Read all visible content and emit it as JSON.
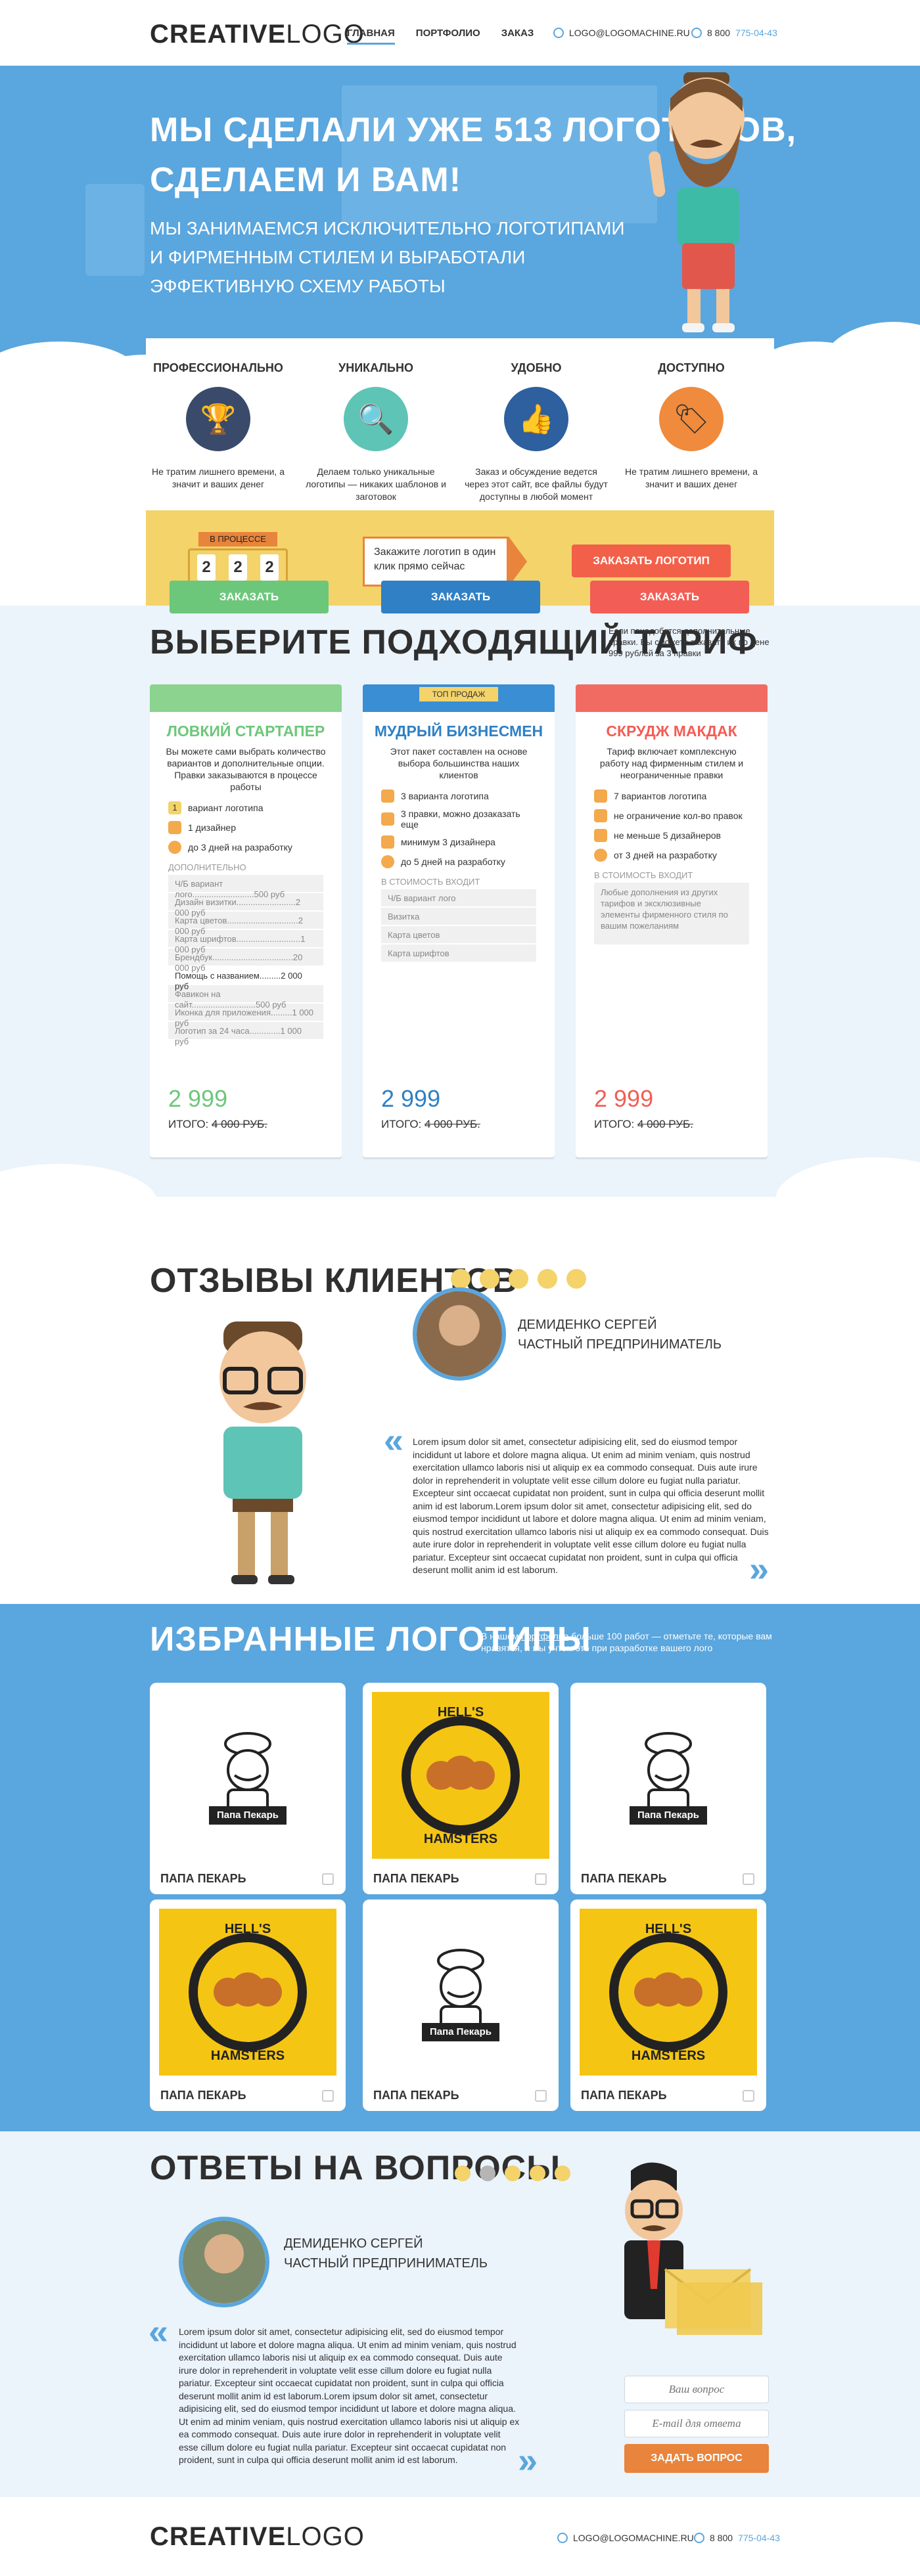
{
  "header": {
    "logo_bold": "CREATIVE",
    "logo_light": "LOGO",
    "nav": [
      "ГЛАВНАЯ",
      "ПОРТФОЛИО",
      "ЗАКАЗ"
    ],
    "email": "LOGO@LOGOMACHINE.RU",
    "phone_prefix": "8 800",
    "phone_rest": "775-04-43"
  },
  "hero": {
    "title_line1": "МЫ СДЕЛАЛИ УЖЕ 513 ЛОГОТИПОВ,",
    "title_line2": "СДЕЛАЕМ И ВАМ!",
    "subtitle": "МЫ ЗАНИМАЕМСЯ ИСКЛЮЧИТЕЛЬНО ЛОГОТИПАМИ И ФИРМЕННЫМ СТИЛЕМ И ВЫРАБОТАЛИ ЭФФЕКТИВНУЮ СХЕМУ РАБОТЫ"
  },
  "features": [
    {
      "title": "ПРОФЕССИОНАЛЬНО",
      "text": "Не тратим лишнего времени, а значит и ваших денег",
      "icon": "trophy-icon",
      "color": "#3a4a6b",
      "glyph": "🏆"
    },
    {
      "title": "УНИКАЛЬНО",
      "text": "Делаем только уникальные логотипы — никаких шаблонов и заготовок",
      "icon": "magnifier-icon",
      "color": "#5ec4b6",
      "glyph": "🔍"
    },
    {
      "title": "УДОБНО",
      "text": "Заказ и обсуждение ведется через этот сайт, все файлы будут доступны в любой момент",
      "icon": "thumbs-up-icon",
      "color": "#2e5f9e",
      "glyph": "👍"
    },
    {
      "title": "ДОСТУПНО",
      "text": "Не тратим лишнего времени, а значит и ваших денег",
      "icon": "price-tag-icon",
      "color": "#f08a3c",
      "glyph": "🏷"
    }
  ],
  "progress": {
    "label": "В ПРОЦЕССЕ",
    "digits": [
      "2",
      "2",
      "2"
    ],
    "callout": "Закажите логотип в один клик прямо сейчас",
    "button": "ЗАКАЗАТЬ ЛОГОТИП"
  },
  "tariff": {
    "title": "ВЫБЕРИТЕ ПОДХОДЯЩИЙ ТАРИФ",
    "note": "Если понадобятся дополнительные правки. Вы сможете заказать их по цене 999 рублей за 3 правки",
    "top_badge": "ТОП ПРОДАЖ",
    "included_label": "В СТОИМОСТЬ ВХОДИТ",
    "extra_label": "ДОПОЛНИТЕЛЬНО",
    "total_label": "ИТОГО:",
    "cards": [
      {
        "name": "ЛОВКИЙ СТАРТАПЕР",
        "desc": "Вы можете сами выбрать количество вариантов и дополнительные опции. Правки заказываются в процессе работы",
        "features": [
          "вариант логотипа",
          "1 дизайнер",
          "до 3 дней на разработку"
        ],
        "stepper": "1",
        "extras": [
          "Ч/Б вариант лого..........................500 руб",
          "Дизайн визитки.........................2 000 руб",
          "Карта цветов..............................2 000 руб",
          "Карта шрифтов...........................1 000 руб",
          "Брендбук..................................20 000 руб",
          "Помощь с названием.........2 000 руб",
          "Фавикон на сайт...........................500 руб",
          "Иконка для приложения.........1 000 руб",
          "Логотип за 24 часа.............1 000 руб"
        ],
        "price": "2 999",
        "old_price": "4 000 РУБ.",
        "button": "ЗАКАЗАТЬ",
        "color": "#6cc77a",
        "top": "#8bd38f"
      },
      {
        "name": "МУДРЫЙ БИЗНЕСМЕН",
        "desc": "Этот пакет составлен на основе выбора большинства наших клиентов",
        "features": [
          "3 варианта логотипа",
          "3 правки, можно дозаказать еще",
          "минимум 3 дизайнера",
          "до 5 дней на разработку"
        ],
        "included": [
          "Ч/Б вариант лого",
          "Визитка",
          "Карта цветов",
          "Карта шрифтов"
        ],
        "price": "2 999",
        "old_price": "4 000 РУБ.",
        "button": "ЗАКАЗАТЬ",
        "color": "#2f80c4",
        "top": "#3a8ed3"
      },
      {
        "name": "СКРУДЖ МАКДАК",
        "desc": "Тариф включает комплексную работу над фирменным стилем и неограниченные правки",
        "features": [
          "7 вариантов логотипа",
          "не ограничение кол-во правок",
          "не меньше 5 дизайнеров",
          "от 3 дней на разработку"
        ],
        "included_text": "Любые дополнения из других тарифов и эксклюзивные элементы фирменного стиля по вашим пожеланиям",
        "price": "2 999",
        "old_price": "4 000 РУБ.",
        "button": "ЗАКАЗАТЬ",
        "color": "#f25d55",
        "top": "#f26b62"
      }
    ]
  },
  "reviews": {
    "title": "ОТЗЫВЫ КЛИЕНТОВ",
    "name": "ДЕМИДЕНКО СЕРГЕЙ",
    "role": "ЧАСТНЫЙ ПРЕДПРИНИМАТЕЛЬ",
    "text": "Lorem ipsum dolor sit amet, consectetur adipisicing elit, sed do eiusmod tempor incididunt ut labore et dolore magna aliqua. Ut enim ad minim veniam, quis nostrud exercitation ullamco laboris nisi ut aliquip ex ea commodo consequat. Duis aute irure dolor in reprehenderit in voluptate velit esse cillum dolore eu fugiat nulla pariatur. Excepteur sint occaecat cupidatat non proident, sunt in culpa qui officia deserunt mollit anim id est laborum.Lorem ipsum dolor sit amet, consectetur adipisicing elit, sed do eiusmod tempor incididunt ut labore et dolore magna aliqua. Ut enim ad minim veniam, quis nostrud exercitation ullamco laboris nisi ut aliquip ex ea commodo consequat. Duis aute irure dolor in reprehenderit in voluptate velit esse cillum dolore eu fugiat nulla pariatur. Excepteur sint occaecat cupidatat non proident, sunt in culpa qui officia deserunt mollit anim id est laborum."
  },
  "logos": {
    "title": "ИЗБРАННЫЕ ЛОГОТИПЫ",
    "note_pre": "В нашем",
    "note_link": "портфолио",
    "note_post": "больше 100 работ — отметьте те, которые вам нравятся, и мы учтем это при разработке вашего лого",
    "items": [
      {
        "caption": "ПАПА ПЕКАРЬ",
        "kind": "papa"
      },
      {
        "caption": "ПАПА ПЕКАРЬ",
        "kind": "hell"
      },
      {
        "caption": "ПАПА ПЕКАРЬ",
        "kind": "papa"
      },
      {
        "caption": "ПАПА ПЕКАРЬ",
        "kind": "hell"
      },
      {
        "caption": "ПАПА ПЕКАРЬ",
        "kind": "papa"
      },
      {
        "caption": "ПАПА ПЕКАРЬ",
        "kind": "hell"
      }
    ],
    "papa_text": "Папа Пекарь",
    "hell_text_top": "HELL'S",
    "hell_text_bottom": "HAMSTERS"
  },
  "faq": {
    "title": "ОТВЕТЫ НА ВОПРОСЫ",
    "name": "ДЕМИДЕНКО СЕРГЕЙ",
    "role": "ЧАСТНЫЙ ПРЕДПРИНИМАТЕЛЬ",
    "text": "Lorem ipsum dolor sit amet, consectetur adipisicing elit, sed do eiusmod tempor incididunt ut labore et dolore magna aliqua. Ut enim ad minim veniam, quis nostrud exercitation ullamco laboris nisi ut aliquip ex ea commodo consequat. Duis aute irure dolor in reprehenderit in voluptate velit esse cillum dolore eu fugiat nulla pariatur. Excepteur sint occaecat cupidatat non proident, sunt in culpa qui officia deserunt mollit anim id est laborum.Lorem ipsum dolor sit amet, consectetur adipisicing elit, sed do eiusmod tempor incididunt ut labore et dolore magna aliqua. Ut enim ad minim veniam, quis nostrud exercitation ullamco laboris nisi ut aliquip ex ea commodo consequat. Duis aute irure dolor in reprehenderit in voluptate velit esse cillum dolore eu fugiat nulla pariatur. Excepteur sint occaecat cupidatat non proident, sunt in culpa qui officia deserunt mollit anim id est laborum.",
    "question_placeholder": "Ваш вопрос",
    "email_placeholder": "E-mail для ответа",
    "button": "ЗАДАТЬ ВОПРОС"
  },
  "colors": {
    "blue": "#5aa6de",
    "yellow": "#f3d36a",
    "orange": "#e8843b",
    "red": "#f26049",
    "grey_dot": "#b5b5b5"
  }
}
